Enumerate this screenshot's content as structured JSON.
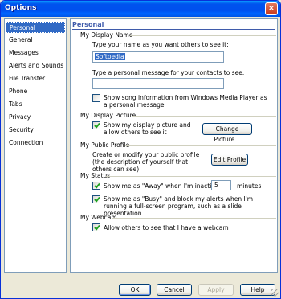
{
  "window": {
    "title": "Options",
    "close_glyph": "×"
  },
  "sidebar": {
    "items": [
      {
        "label": "Personal",
        "selected": true
      },
      {
        "label": "General"
      },
      {
        "label": "Messages"
      },
      {
        "label": "Alerts and Sounds"
      },
      {
        "label": "File Transfer"
      },
      {
        "label": "Phone"
      },
      {
        "label": "Tabs"
      },
      {
        "label": "Privacy"
      },
      {
        "label": "Security"
      },
      {
        "label": "Connection"
      }
    ]
  },
  "panel": {
    "title": "Personal",
    "display_name": {
      "section": "My Display Name",
      "name_prompt": "Type your name as you want others to see it:",
      "name_value": "Softpedia",
      "message_prompt": "Type a personal message for your contacts to see:",
      "message_value": "",
      "song_label": "Show song information from Windows Media Player as a personal message"
    },
    "display_picture": {
      "section": "My Display Picture",
      "show_label": "Show my display picture and allow others to see it",
      "change_button": "Change Picture..."
    },
    "public_profile": {
      "section": "My Public Profile",
      "desc": "Create or modify your public profile (the description of yourself that others can see)",
      "edit_button": "Edit Profile"
    },
    "status": {
      "section": "My Status",
      "away_label": "Show me as \"Away\" when I'm inactive for",
      "away_value": "5",
      "away_unit": "minutes",
      "busy_label": "Show me as \"Busy\" and block my alerts when I'm running a full-screen program, such as a slide presentation"
    },
    "webcam": {
      "section": "My Webcam",
      "allow_label": "Allow others to see that I have a webcam"
    }
  },
  "footer": {
    "ok": "OK",
    "cancel": "Cancel",
    "apply": "Apply",
    "help": "Help"
  }
}
